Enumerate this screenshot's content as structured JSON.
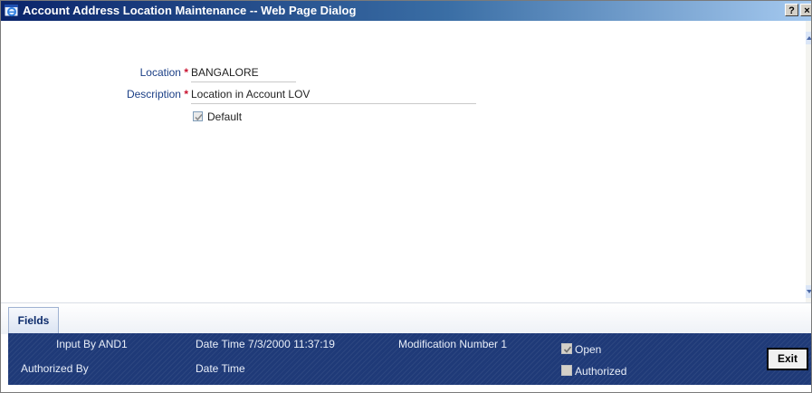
{
  "window": {
    "title": "Account Address Location Maintenance -- Web Page Dialog",
    "help_label": "?",
    "close_label": "×"
  },
  "form": {
    "location_label": "Location",
    "location_value": "BANGALORE",
    "description_label": "Description",
    "description_value": "Location in Account LOV",
    "required_marker": "*",
    "default_label": "Default",
    "default_checked": true
  },
  "tabs": [
    {
      "label": "Fields"
    }
  ],
  "audit": {
    "input_by_label": "Input By",
    "input_by_value": "AND1",
    "date_time_label": "Date Time",
    "date_time_value": "7/3/2000 11:37:19",
    "modification_number_label": "Modification Number",
    "modification_number_value": "1",
    "authorized_by_label": "Authorized By",
    "authorized_date_time_label": "Date Time",
    "open_label": "Open",
    "open_checked": true,
    "authorized_label": "Authorized",
    "authorized_checked": false
  },
  "buttons": {
    "exit_label": "Exit"
  },
  "icons": {
    "app": "ie-window-icon",
    "help": "help-icon",
    "close": "close-icon",
    "scroll_up": "scroll-up-icon",
    "scroll_down": "scroll-down-icon"
  },
  "colors": {
    "title_start": "#0a246a",
    "title_end": "#a6caf0",
    "label": "#1b3f86",
    "required": "#c8102e",
    "audit_bg": "#1f3a78"
  }
}
